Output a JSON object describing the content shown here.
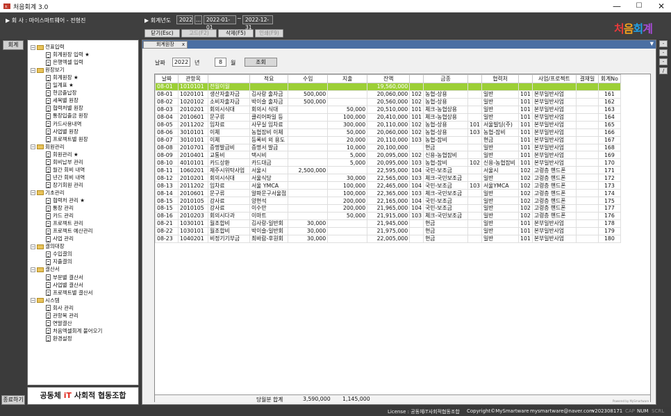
{
  "window": {
    "title": "처음회계 3.0",
    "min": "—",
    "max": "☐",
    "close": "✕"
  },
  "header": {
    "company_label": "▶ 회  사 : 마이스마트웨어 - 전형진",
    "fiscal_label": "▶ 회계년도",
    "fiscal_year": "2022",
    "fiscal_ellipsis": "...",
    "date_from": "2022-01-01",
    "tilde": "~",
    "date_to": "2022-12-31",
    "buttons": {
      "close": "닫기(Esc)",
      "edit": "고드(F2)",
      "delete": "삭제(F5)",
      "print": "인쇄(F9)"
    },
    "logo": [
      "처",
      "음",
      "회",
      "계"
    ],
    "logo_colors": [
      "#e8393a",
      "#f4a11c",
      "#21a0e6",
      "#a84bd8"
    ]
  },
  "left": {
    "vtab": "회계",
    "close": "종료하기"
  },
  "tree": [
    {
      "t": "folder",
      "label": "전표입력",
      "pm": "−",
      "lvl": 0
    },
    {
      "t": "doc",
      "label": "회계원장 입력 ★",
      "lvl": 1
    },
    {
      "t": "doc",
      "label": "은행엑셀 입력",
      "lvl": 1
    },
    {
      "t": "folder",
      "label": "원장보기",
      "pm": "−",
      "lvl": 0
    },
    {
      "t": "doc",
      "label": "회계원장 ★",
      "lvl": 1
    },
    {
      "t": "doc",
      "label": "일계표 ★",
      "lvl": 1
    },
    {
      "t": "doc",
      "label": "현금출납장",
      "lvl": 1
    },
    {
      "t": "doc",
      "label": "세목별 원장",
      "lvl": 1
    },
    {
      "t": "doc",
      "label": "협력처별 원장",
      "lvl": 1
    },
    {
      "t": "doc",
      "label": "통장입출금 원장",
      "lvl": 1
    },
    {
      "t": "doc",
      "label": "카드사용내역",
      "lvl": 1
    },
    {
      "t": "doc",
      "label": "사업별 원장",
      "lvl": 1
    },
    {
      "t": "doc",
      "label": "프로젝트별 원장",
      "lvl": 1
    },
    {
      "t": "folder",
      "label": "회원관리",
      "pm": "−",
      "lvl": 0
    },
    {
      "t": "doc",
      "label": "회원관리 ★",
      "lvl": 1
    },
    {
      "t": "doc",
      "label": "회비납부 관리",
      "lvl": 1
    },
    {
      "t": "doc",
      "label": "월간 회비 내역",
      "lvl": 1
    },
    {
      "t": "doc",
      "label": "년간 회비 내역",
      "lvl": 1
    },
    {
      "t": "doc",
      "label": "장기회원 관리",
      "lvl": 1
    },
    {
      "t": "folder",
      "label": "기초관리",
      "pm": "−",
      "lvl": 0
    },
    {
      "t": "doc",
      "label": "협력처 관리 ★",
      "lvl": 1
    },
    {
      "t": "doc",
      "label": "통장 관리",
      "lvl": 1
    },
    {
      "t": "doc",
      "label": "카드 관리",
      "lvl": 1
    },
    {
      "t": "doc",
      "label": "프로젝트 관리",
      "lvl": 1
    },
    {
      "t": "doc",
      "label": "프로젝트 예산관리",
      "lvl": 1
    },
    {
      "t": "doc",
      "label": "사업 관리",
      "lvl": 1
    },
    {
      "t": "folder",
      "label": "결의대장",
      "pm": "−",
      "lvl": 0
    },
    {
      "t": "doc",
      "label": "수입결의",
      "lvl": 1
    },
    {
      "t": "doc",
      "label": "지출결의",
      "lvl": 1
    },
    {
      "t": "folder",
      "label": "결산서",
      "pm": "−",
      "lvl": 0
    },
    {
      "t": "doc",
      "label": "부문별 결산서",
      "lvl": 1
    },
    {
      "t": "doc",
      "label": "사업별 결산서",
      "lvl": 1
    },
    {
      "t": "doc",
      "label": "프로젝트별 결산서",
      "lvl": 1
    },
    {
      "t": "folder",
      "label": "시스템",
      "pm": "−",
      "lvl": 0
    },
    {
      "t": "doc",
      "label": "회사 관리",
      "lvl": 1
    },
    {
      "t": "doc",
      "label": "관항목 관리",
      "lvl": 1
    },
    {
      "t": "doc",
      "label": "연말결산",
      "lvl": 1
    },
    {
      "t": "doc",
      "label": "처음엑셀회계 불어오기",
      "lvl": 1
    },
    {
      "t": "doc",
      "label": "환경설정",
      "lvl": 1
    }
  ],
  "brand": {
    "prefix": "공동체",
    "it": "iT",
    "suffix": "사회적 협동조합"
  },
  "main": {
    "tab": "회계원장",
    "tab_close": "x",
    "tab_dropdown": "▼",
    "filter": {
      "date_label": "날짜",
      "year": "2022",
      "year_suffix": "년",
      "month": "8",
      "month_suffix": "월",
      "search": "조회"
    },
    "side_btns": [
      "-",
      "-",
      "-",
      "/"
    ],
    "powered": "Powered by MySmartware"
  },
  "grid": {
    "headers": [
      "날짜",
      "관항목",
      "",
      "적요",
      "수입",
      "지출",
      "잔액",
      "",
      "금종",
      "",
      "협력처",
      "",
      "사업/프로젝트",
      "결재일",
      "회계No"
    ],
    "rows": [
      [
        "08-01",
        "1010101",
        "전월이월",
        "",
        "",
        "",
        "19,560,000",
        "",
        "",
        "",
        "",
        "",
        "",
        "",
        ""
      ],
      [
        "08-01",
        "1020101",
        "생산자출자금",
        "김사랑 출자금",
        "500,000",
        "",
        "20,060,000",
        "102",
        "농협-상용",
        "",
        "일반",
        "101",
        "본부일반사업",
        "",
        "161"
      ],
      [
        "08-02",
        "1020102",
        "소비자출자금",
        "박이슬 출자금",
        "500,000",
        "",
        "20,560,000",
        "102",
        "농협-상용",
        "",
        "일반",
        "101",
        "본부일반사업",
        "",
        "162"
      ],
      [
        "08-03",
        "2010201",
        "회의시식대",
        "회의시 식대",
        "",
        "50,000",
        "20,510,000",
        "101",
        "체크-농협상용",
        "",
        "일반",
        "101",
        "본부일반사업",
        "",
        "163"
      ],
      [
        "08-04",
        "2010601",
        "문구류",
        "클리어파일 등",
        "",
        "100,000",
        "20,410,000",
        "101",
        "체크-농협상용",
        "",
        "일반",
        "101",
        "본부일반사업",
        "",
        "164"
      ],
      [
        "08-05",
        "2011202",
        "임차료",
        "사무실 임차료",
        "",
        "300,000",
        "20,110,000",
        "102",
        "농협-상용",
        "101",
        "서울빌딩(주)",
        "101",
        "본부일반사업",
        "",
        "165"
      ],
      [
        "08-06",
        "3010101",
        "이체",
        "농협잡비 이체",
        "",
        "50,000",
        "20,060,000",
        "102",
        "농협-상용",
        "103",
        "농협-잡비",
        "101",
        "본부일반사업",
        "",
        "166"
      ],
      [
        "08-07",
        "3010101",
        "이체",
        "등록비 외 용도",
        "",
        "20,000",
        "20,110,000",
        "103",
        "농협-잡비",
        "",
        "현금",
        "101",
        "본부일반사업",
        "",
        "167"
      ],
      [
        "08-08",
        "2010701",
        "증명발급비",
        "증명서 발급",
        "",
        "10,000",
        "20,100,000",
        "",
        "현금",
        "",
        "일반",
        "101",
        "본부일반사업",
        "",
        "168"
      ],
      [
        "08-09",
        "2010401",
        "교통비",
        "택시비",
        "",
        "5,000",
        "20,095,000",
        "102",
        "신용-농협잡비",
        "",
        "일반",
        "101",
        "본부일반사업",
        "",
        "169"
      ],
      [
        "08-10",
        "4010101",
        "카드상환",
        "카드대금",
        "",
        "5,000",
        "20,095,000",
        "103",
        "농협-잡비",
        "102",
        "신용-농협잡비",
        "101",
        "본부일반사업",
        "",
        "170"
      ],
      [
        "08-11",
        "1060201",
        "제주시위탁사업",
        "서울시",
        "2,500,000",
        "",
        "22,595,000",
        "104",
        "국민-보조금",
        "",
        "서울시",
        "102",
        "고령층 핸드폰",
        "",
        "171"
      ],
      [
        "08-12",
        "2010201",
        "회의시식대",
        "서울식당",
        "",
        "30,000",
        "22,565,000",
        "103",
        "체크-국민보조금",
        "",
        "일반",
        "102",
        "고령층 핸드폰",
        "",
        "172"
      ],
      [
        "08-13",
        "2011202",
        "임차료",
        "서울 YMCA",
        "",
        "100,000",
        "22,465,000",
        "104",
        "국민-보조금",
        "103",
        "서울YMCA",
        "102",
        "고령층 핸드폰",
        "",
        "173"
      ],
      [
        "08-14",
        "2010601",
        "문구류",
        "알파문구서울점",
        "",
        "100,000",
        "22,365,000",
        "103",
        "체크-국민보조금",
        "",
        "일반",
        "102",
        "고령층 핸드폰",
        "",
        "174"
      ],
      [
        "08-15",
        "2010105",
        "강사료",
        "양현석",
        "",
        "200,000",
        "22,165,000",
        "104",
        "국민-보조금",
        "",
        "일반",
        "102",
        "고령층 핸드폰",
        "",
        "175"
      ],
      [
        "08-15",
        "2010105",
        "강사료",
        "이수만",
        "",
        "200,000",
        "21,965,000",
        "104",
        "국민-보조금",
        "",
        "일반",
        "102",
        "고령층 핸드폰",
        "",
        "177"
      ],
      [
        "08-16",
        "2010203",
        "회의시다과",
        "이마트",
        "",
        "50,000",
        "21,915,000",
        "103",
        "체크-국민보조금",
        "",
        "일반",
        "102",
        "고령층 핸드폰",
        "",
        "176"
      ],
      [
        "08-21",
        "1030101",
        "월조합비",
        "김사랑-일반회",
        "30,000",
        "",
        "21,945,000",
        "",
        "현금",
        "",
        "일반",
        "101",
        "본부일반사업",
        "",
        "178"
      ],
      [
        "08-22",
        "1030101",
        "월조합비",
        "박이슬-일반회",
        "30,000",
        "",
        "21,975,000",
        "",
        "현금",
        "",
        "일반",
        "101",
        "본부일반사업",
        "",
        "179"
      ],
      [
        "08-23",
        "1040201",
        "비정기기부금",
        "최바람-후원회",
        "30,000",
        "",
        "22,005,000",
        "",
        "현금",
        "",
        "일반",
        "101",
        "본부일반사업",
        "",
        "180"
      ]
    ],
    "footer": {
      "label": "당월분 합계",
      "income": "3,590,000",
      "expense": "1,145,000"
    }
  },
  "status": {
    "license": "License : 공동체iT사회적협동조합",
    "copyright": "Copyright©MySmartware",
    "email": "mysmartware@naver.com",
    "version": "v202308171",
    "cap": "CAP",
    "num": "NUM",
    "scrl": "SCRL"
  }
}
